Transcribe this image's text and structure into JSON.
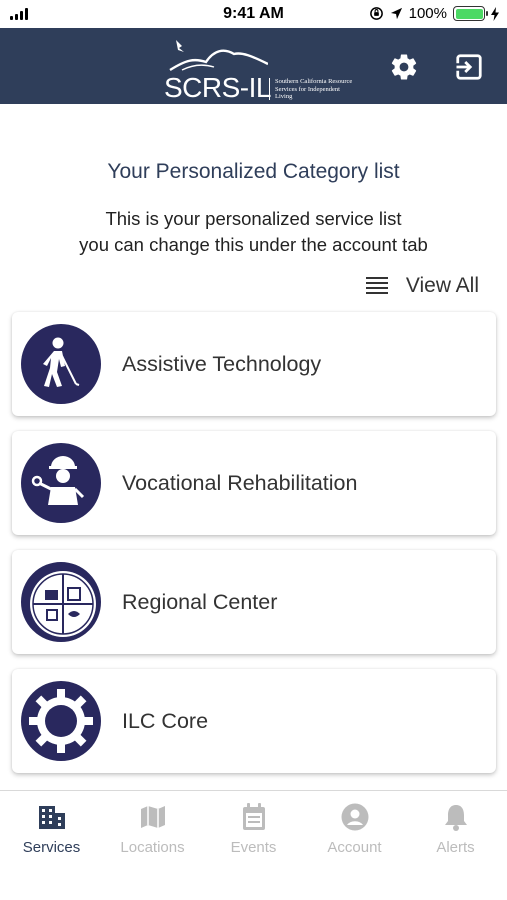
{
  "status_bar": {
    "time": "9:41 AM",
    "battery": "100%"
  },
  "header": {
    "logo_text": "SCRS-IL",
    "logo_subtitle": "Southern California Resource Services for Independent Living",
    "settings_icon": "gear-icon",
    "logout_icon": "sign-out-icon"
  },
  "content": {
    "title": "Your Personalized Category list",
    "description_line1": "This is your personalized service list",
    "description_line2": "you can change this under the account tab",
    "view_all_label": "View All"
  },
  "categories": [
    {
      "label": "Assistive Technology",
      "icon": "person-with-cane-icon"
    },
    {
      "label": "Vocational Rehabilitation",
      "icon": "worker-with-wrench-icon"
    },
    {
      "label": "Regional Center",
      "icon": "regional-center-seal-icon"
    },
    {
      "label": "ILC Core",
      "icon": "gears-icon"
    }
  ],
  "tabs": [
    {
      "label": "Services",
      "icon": "building-icon",
      "active": true
    },
    {
      "label": "Locations",
      "icon": "map-icon",
      "active": false
    },
    {
      "label": "Events",
      "icon": "calendar-icon",
      "active": false
    },
    {
      "label": "Account",
      "icon": "user-circle-icon",
      "active": false
    },
    {
      "label": "Alerts",
      "icon": "bell-icon",
      "active": false
    }
  ],
  "colors": {
    "header_bg": "#2f3e5a",
    "icon_bg": "#29285e",
    "tab_active": "#2f3e5a",
    "tab_inactive": "#bcbcbc",
    "battery": "#4cd964"
  }
}
